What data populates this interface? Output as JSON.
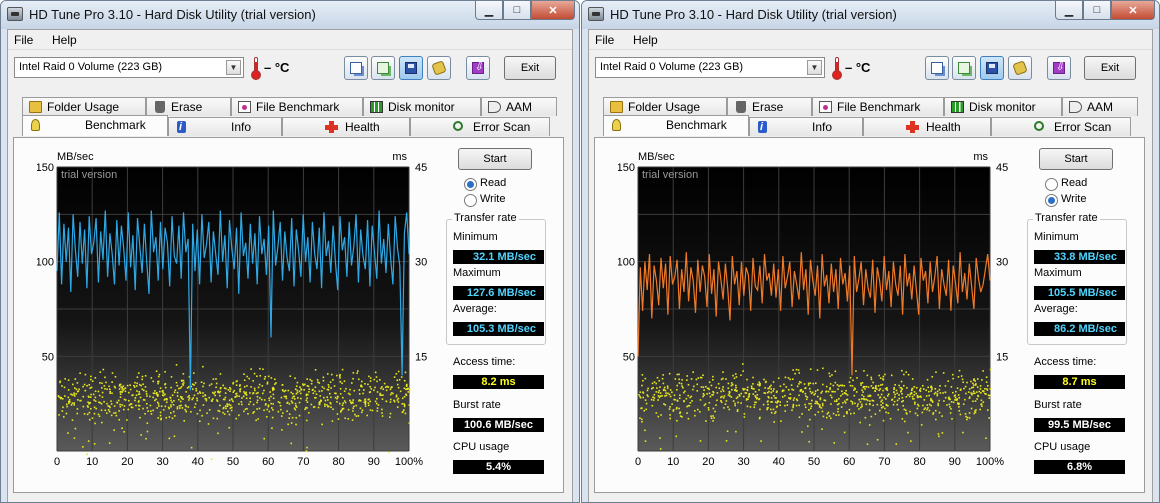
{
  "windows": [
    {
      "title": "HD Tune Pro 3.10 - Hard Disk Utility (trial version)",
      "menu": [
        "File",
        "Help"
      ],
      "drive": "Intel   Raid 0 Volume (223 GB)",
      "temperature": "– °C",
      "exit_label": "Exit",
      "tabs_top": [
        "Folder Usage",
        "Erase",
        "File Benchmark",
        "Disk monitor",
        "AAM"
      ],
      "tabs_bottom": [
        "Benchmark",
        "Info",
        "Health",
        "Error Scan"
      ],
      "start_label": "Start",
      "mode": "Read",
      "read_label": "Read",
      "write_label": "Write",
      "transfer_rate_label": "Transfer rate",
      "minimum_label": "Minimum",
      "minimum": "32.1 MB/sec",
      "maximum_label": "Maximum",
      "maximum": "127.6 MB/sec",
      "average_label": "Average:",
      "average": "105.3 MB/sec",
      "access_label": "Access time:",
      "access": "8.2 ms",
      "burst_label": "Burst rate",
      "burst": "100.6 MB/sec",
      "cpu_label": "CPU usage",
      "cpu": "5.4%",
      "line_color": "#2fa9e6"
    },
    {
      "title": "HD Tune Pro 3.10 - Hard Disk Utility (trial version)",
      "menu": [
        "File",
        "Help"
      ],
      "drive": "Intel   Raid 0 Volume (223 GB)",
      "temperature": "– °C",
      "exit_label": "Exit",
      "tabs_top": [
        "Folder Usage",
        "Erase",
        "File Benchmark",
        "Disk monitor",
        "AAM"
      ],
      "tabs_bottom": [
        "Benchmark",
        "Info",
        "Health",
        "Error Scan"
      ],
      "start_label": "Start",
      "mode": "Write",
      "read_label": "Read",
      "write_label": "Write",
      "transfer_rate_label": "Transfer rate",
      "minimum_label": "Minimum",
      "minimum": "33.8 MB/sec",
      "maximum_label": "Maximum",
      "maximum": "105.5 MB/sec",
      "average_label": "Average:",
      "average": "86.2 MB/sec",
      "access_label": "Access time:",
      "access": "8.7 ms",
      "burst_label": "Burst rate",
      "burst": "99.5 MB/sec",
      "cpu_label": "CPU usage",
      "cpu": "6.8%",
      "line_color": "#f07a28"
    }
  ],
  "chart_data": [
    {
      "type": "line",
      "left_unit": "MB/sec",
      "right_unit": "ms",
      "watermark": "trial version",
      "left_ticks": [
        "150",
        "100",
        "50"
      ],
      "right_ticks": [
        "45",
        "30",
        "15"
      ],
      "x_ticks": [
        "0",
        "10",
        "20",
        "30",
        "40",
        "50",
        "60",
        "70",
        "80",
        "90",
        "100%"
      ],
      "ylim": [
        0,
        150
      ],
      "y2lim": [
        0,
        45
      ],
      "series": [
        {
          "values": [
            95,
            126,
            88,
            120,
            100,
            118,
            84,
            125,
            106,
            92,
            121,
            99,
            117,
            86,
            124,
            104,
            110,
            123,
            89,
            116,
            101,
            127,
            92,
            115,
            104,
            88,
            122,
            98,
            119,
            107,
            90,
            126,
            97,
            114,
            85,
            123,
            108,
            94,
            120,
            100,
            83,
            127,
            105,
            113,
            90,
            121,
            96,
            118,
            110,
            87,
            124,
            103,
            99,
            119,
            91,
            126,
            105,
            112,
            32,
            120,
            95,
            117,
            88,
            125,
            102,
            109,
            121,
            89,
            116,
            104,
            93,
            127,
            100,
            114,
            86,
            122,
            107,
            96,
            118,
            83,
            126,
            103,
            110,
            91,
            120,
            99,
            115,
            88,
            124,
            104,
            112,
            93,
            119,
            60,
            127,
            98,
            108,
            121,
            90,
            116,
            102,
            95,
            123,
            87,
            117,
            106,
            92,
            125,
            100,
            113,
            89,
            121,
            104,
            96,
            118,
            86,
            126,
            103,
            111,
            94,
            119,
            100,
            85,
            124,
            106,
            113,
            92,
            121,
            98,
            108,
            125,
            89,
            117,
            103,
            96,
            122,
            87,
            119,
            105,
            91,
            127,
            99,
            112,
            94,
            120,
            102,
            88,
            124,
            107,
            98,
            40,
            115,
            126,
            104
          ]
        },
        {
          "values": [
            50,
            97,
            74,
            100,
            85,
            104,
            70,
            98,
            90,
            77,
            102,
            86,
            99,
            72,
            103,
            88,
            92,
            101,
            75,
            96,
            84,
            105,
            79,
            97,
            90,
            73,
            101,
            84,
            98,
            92,
            76,
            104,
            83,
            96,
            71,
            100,
            91,
            80,
            99,
            86,
            69,
            103,
            88,
            95,
            77,
            100,
            82,
            97,
            93,
            74,
            102,
            87,
            85,
            98,
            78,
            104,
            90,
            94,
            82,
            99,
            81,
            96,
            74,
            103,
            86,
            92,
            100,
            76,
            95,
            88,
            80,
            105,
            85,
            96,
            72,
            101,
            90,
            82,
            98,
            70,
            104,
            87,
            93,
            78,
            99,
            84,
            96,
            75,
            102,
            88,
            94,
            79,
            98,
            40,
            103,
            84,
            91,
            100,
            77,
            96,
            86,
            81,
            101,
            73,
            97,
            90,
            79,
            103,
            85,
            95,
            76,
            100,
            88,
            82,
            98,
            72,
            104,
            87,
            94,
            80,
            98,
            85,
            72,
            102,
            90,
            95,
            78,
            100,
            84,
            92,
            103,
            75,
            96,
            88,
            82,
            101,
            74,
            98,
            89,
            78,
            105,
            84,
            94,
            80,
            99,
            87,
            75,
            102,
            91,
            84,
            88,
            96,
            104,
            90
          ]
        }
      ]
    }
  ]
}
